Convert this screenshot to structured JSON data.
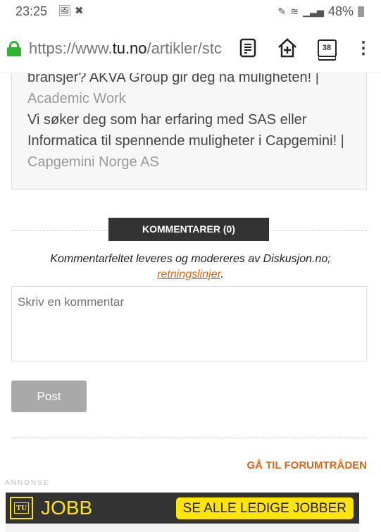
{
  "status": {
    "time": "23:25",
    "battery": "48%"
  },
  "browser": {
    "url_prefix": "https://www.",
    "url_domain": "tu.no",
    "url_path": "/artikler/stc",
    "tab_count": "38"
  },
  "jobs": {
    "items": [
      {
        "text": "bransjer? AKVA Group gir deg nå muligheten! |",
        "source": "Academic Work"
      },
      {
        "text": "Vi søker deg som har erfaring med SAS eller Informatica til spennende muligheter i Capgemini! |",
        "source": "Capgemini Norge AS"
      }
    ]
  },
  "comments": {
    "heading": "KOMMENTARER (0)",
    "note": "Kommentarfeltet leveres og modereres av Diskusjon.no;",
    "link": "retningslinjer",
    "after_link": ".",
    "placeholder": "Skriv en kommentar",
    "post_label": "Post",
    "forum_link": "GÅ TIL FORUMTRÅDEN"
  },
  "ad": {
    "label": "ANNONSE",
    "logo": "TU",
    "brand": "JOBB",
    "cta": "SE ALLE LEDIGE JOBBER"
  }
}
